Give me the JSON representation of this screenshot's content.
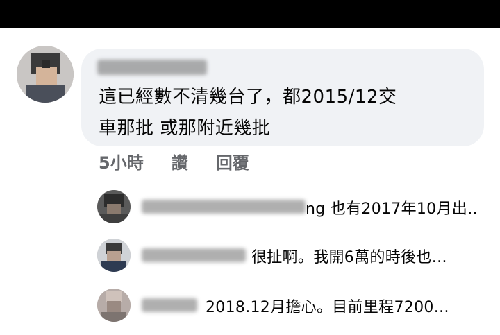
{
  "comment": {
    "line1": "這已經數不清幾台了，都2015/12交",
    "line2": "車那批 或那附近幾批",
    "time": "5小時",
    "like_label": "讚",
    "reply_label": "回覆"
  },
  "replies": [
    {
      "text": "ng 也有2017年10月出…"
    },
    {
      "text": "很扯啊。我開6萬的時後也…"
    },
    {
      "text": "2018.12月擔心。目前里程7200…"
    }
  ]
}
